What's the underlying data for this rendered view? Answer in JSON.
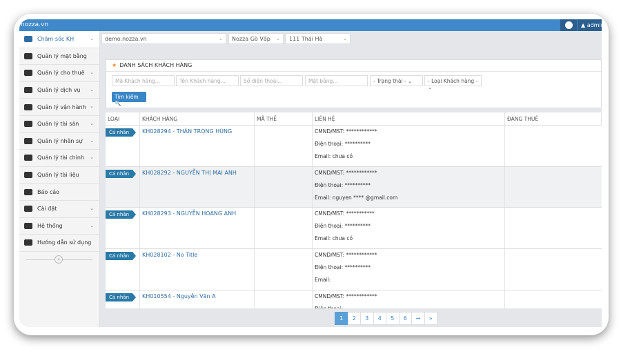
{
  "app": {
    "brand": "nozza.vn",
    "user": "admin"
  },
  "sidebar": {
    "items": [
      {
        "label": "Chăm sóc KH",
        "icon": "inbox-icon",
        "chevron": true,
        "active": true
      },
      {
        "label": "Quản lý mặt bằng",
        "icon": "cubes-icon",
        "chevron": false
      },
      {
        "label": "Quản lý cho thuê",
        "icon": "home-icon",
        "chevron": true
      },
      {
        "label": "Quản lý dịch vụ",
        "icon": "coffee-icon",
        "chevron": true
      },
      {
        "label": "Quản lý vận hành",
        "icon": "wrench-icon",
        "chevron": true
      },
      {
        "label": "Quản lý tài sản",
        "icon": "folder-icon",
        "chevron": true
      },
      {
        "label": "Quản lý nhân sự",
        "icon": "users-icon",
        "chevron": true
      },
      {
        "label": "Quản lý tài chính",
        "icon": "money-icon",
        "chevron": true
      },
      {
        "label": "Quản lý tài liệu",
        "icon": "folder-open-icon",
        "chevron": false
      },
      {
        "label": "Báo cáo",
        "icon": "line-chart-icon",
        "chevron": false
      },
      {
        "label": "Cài đặt",
        "icon": "gear-icon",
        "chevron": true
      },
      {
        "label": "Hệ thống",
        "icon": "gears-icon",
        "chevron": true
      },
      {
        "label": "Hướng dẫn sử dụng",
        "icon": "question-icon",
        "chevron": false
      }
    ],
    "collapse": "«"
  },
  "selectors": {
    "site": "demo.nozza.vn",
    "branch": "Nozza Gò Vấp",
    "building": "111 Thái Hà",
    "arrow": "⌄"
  },
  "panel": {
    "title": "DANH SÁCH KHÁCH HÀNG",
    "filters": {
      "code": "Mã Khách hàng...",
      "name": "Tên Khách hàng...",
      "phone": "Số điện thoại...",
      "space": "Mặt bằng...",
      "status": "- Trạng thái -",
      "type": "- Loại Khách hàng -"
    },
    "search": "Tìm kiếm 🔍"
  },
  "table": {
    "columns": [
      "LOẠI",
      "KHÁCH HÀNG",
      "MÃ THẺ",
      "LIÊN HỆ",
      "ĐANG THUÊ"
    ],
    "rows": [
      {
        "type": "Cá nhân",
        "customer": "KH028294 - THÂN TRỌNG HÙNG",
        "id": "CMND/MST: ************",
        "phone": "Điện thoại: **********",
        "email": "Email: chưa có"
      },
      {
        "type": "Cá nhân",
        "customer": "KH028292 - NGUYỄN THỊ MAI ANH",
        "id": "CMND/MST:  ************",
        "phone": "Điện thoại: **********",
        "email": "Email: nguyen **** @gmail.com"
      },
      {
        "type": "Cá nhân",
        "customer": "KH028293 - NGUYỄN HOÀNG ANH",
        "id": "CMND/MST: ***********",
        "phone": "Điện thoại: **********",
        "email": "Email: chưa có"
      },
      {
        "type": "Cá nhân",
        "customer": "KH028102 - No Title",
        "id": "CMND/MST: ************",
        "phone": "Điện thoại: **********",
        "email": "Email:"
      },
      {
        "type": "Cá nhân",
        "customer": "KH010554 - Nguyễn Văn A",
        "id": "CMND/MST: ************",
        "phone": "Điện thoại:",
        "email": ""
      }
    ]
  },
  "pagination": {
    "pages": [
      "1",
      "2",
      "3",
      "4",
      "5",
      "6",
      "→",
      "»"
    ],
    "current": "1"
  }
}
